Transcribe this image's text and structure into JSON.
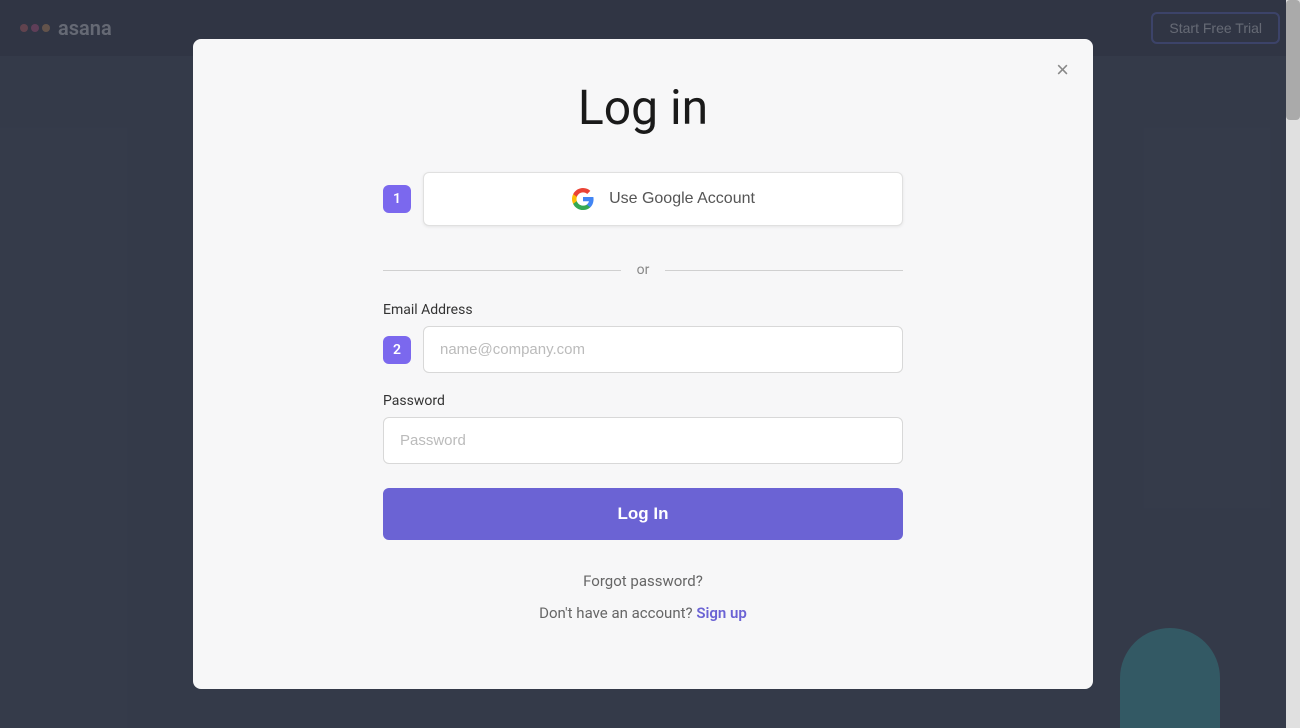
{
  "app": {
    "logo_text": "asana",
    "start_trial_label": "Start Free Trial"
  },
  "modal": {
    "title": "Log in",
    "close_label": "×",
    "google_button_label": "Use Google Account",
    "step1_badge": "1",
    "step2_badge": "2",
    "or_text": "or",
    "email_label": "Email Address",
    "email_placeholder": "name@company.com",
    "password_label": "Password",
    "password_placeholder": "Password",
    "login_button_label": "Log In",
    "forgot_password_label": "Forgot password?",
    "no_account_text": "Don't have an account?",
    "signup_label": "Sign up"
  }
}
